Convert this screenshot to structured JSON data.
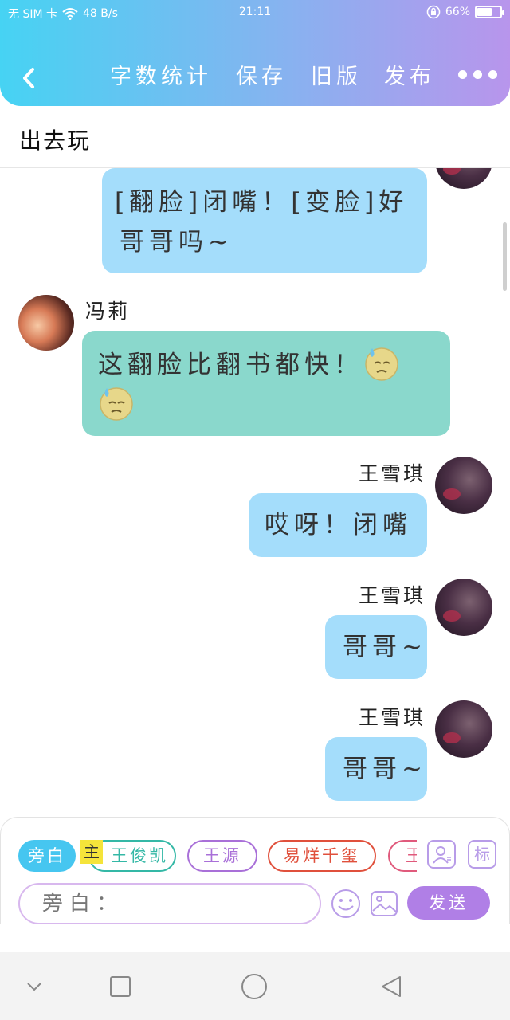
{
  "status_bar": {
    "carrier": "无 SIM 卡",
    "speed": "48 B/s",
    "time": "21:11",
    "battery_label": "66%",
    "battery_level": 0.66
  },
  "nav": {
    "word_count": "字数统计",
    "save": "保存",
    "old_version": "旧版",
    "publish": "发布"
  },
  "page": {
    "title": "出去玩"
  },
  "messages": [
    {
      "side": "right",
      "color": "blue",
      "lines": [
        "[翻脸]闭嘴！[变脸]好",
        "哥哥吗~"
      ]
    },
    {
      "side": "left",
      "sender": "冯莉",
      "color": "teal",
      "line1": "这翻脸比翻书都快！",
      "emoji": "sweat-emoji"
    },
    {
      "side": "right",
      "sender": "王雪琪",
      "color": "blue",
      "text": "哎呀！闭嘴"
    },
    {
      "side": "right",
      "sender": "王雪琪",
      "color": "blue",
      "text": "哥哥~"
    },
    {
      "side": "right",
      "sender": "王雪琪",
      "color": "blue",
      "text": "哥哥~"
    }
  ],
  "composer": {
    "roles": [
      {
        "label": "旁白",
        "color": "#46c6f0",
        "active": true
      },
      {
        "label": "王俊凯",
        "color": "#34b8a6",
        "tag": "主"
      },
      {
        "label": "王源",
        "color": "#a970d8"
      },
      {
        "label": "易烊千玺",
        "color": "#e0503c"
      },
      {
        "label": "王",
        "color": "#e05a7c"
      }
    ],
    "avatar_button_icon": "person-icon",
    "tag_button_label": "标",
    "input_placeholder": "旁白：",
    "emoji_icon": "smiley-icon",
    "image_icon": "image-icon",
    "send_label": "发送"
  },
  "colors": {
    "header_start": "#46d3f3",
    "header_end": "#b895ec",
    "bubble_blue": "#a4ddfb",
    "bubble_teal": "#8ad8cc",
    "send": "#b07fe6"
  }
}
